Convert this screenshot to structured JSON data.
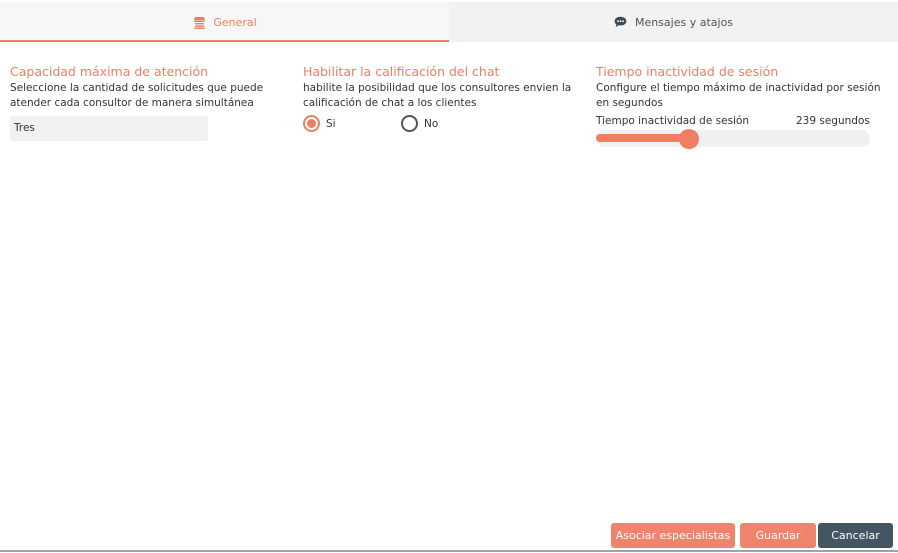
{
  "tabs": [
    {
      "label": "General",
      "icon": "store-icon",
      "active": true
    },
    {
      "label": "Mensajes y atajos",
      "icon": "chat-bubble-icon",
      "active": false
    }
  ],
  "capacity": {
    "title": "Capacidad máxima de atención",
    "description": "Seleccione la cantidad de solicitudes que puede atender cada consultor de manera simultánea",
    "value": "Tres"
  },
  "rating": {
    "title": "Habilitar la calificación del chat",
    "description": "habilite la posibilidad que los consultores envien la calificación de chat a los clientes",
    "options": [
      "Si",
      "No"
    ],
    "selected": "Si"
  },
  "inactivity": {
    "title": "Tiempo inactividad de sesión",
    "description": "Configure el tiempo máximo de inactividad por sesión en segundos",
    "slider_label": "Tiempo inactividad de sesión",
    "value_text": "239 segundos",
    "fill_fraction": 0.34
  },
  "footer": {
    "associate_label": "Asociar especialistas",
    "save_label": "Guardar",
    "cancel_label": "Cancelar"
  },
  "colors": {
    "accent": "#ef7e63",
    "dark_button": "#435661"
  }
}
